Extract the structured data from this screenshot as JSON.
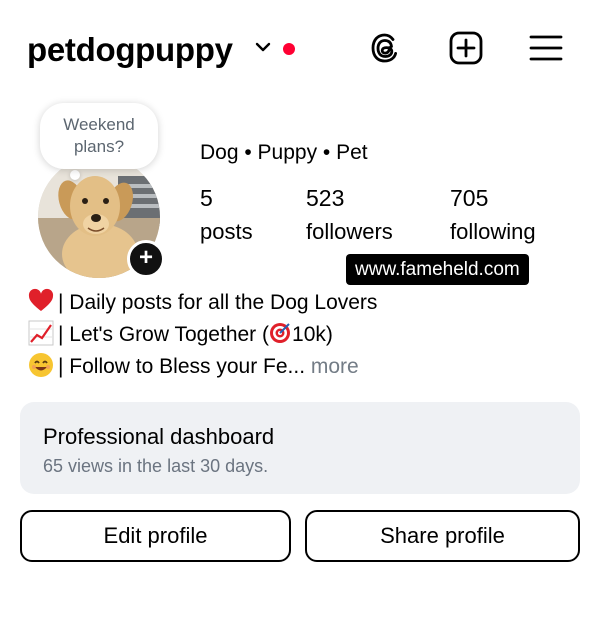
{
  "header": {
    "username": "petdogpuppy",
    "accent_color": "#ff0033",
    "icons": [
      "chevron-down-icon",
      "threads-icon",
      "add-post-icon",
      "menu-icon"
    ]
  },
  "profile": {
    "note": [
      "Weekend",
      "plans?"
    ],
    "category": "Dog • Puppy • Pet",
    "stats": [
      {
        "value": "5",
        "label": "posts"
      },
      {
        "value": "523",
        "label": "followers"
      },
      {
        "value": "705",
        "label": "following"
      }
    ],
    "website_overlay": "www.fameheld.com"
  },
  "bio": {
    "line1": "| Daily posts for all the Dog Lovers",
    "line2": "| Let's Grow Together (",
    "line2_end": "10k)",
    "line3": "| Follow to Bless your Fe...",
    "more": " more",
    "emoji": [
      "heart-emoji",
      "chart-increasing-emoji",
      "target-emoji",
      "smiling-face-emoji"
    ]
  },
  "dashboard": {
    "title": "Professional dashboard",
    "subtitle": "65 views in the last 30 days."
  },
  "buttons": {
    "edit": "Edit profile",
    "share": "Share profile"
  }
}
